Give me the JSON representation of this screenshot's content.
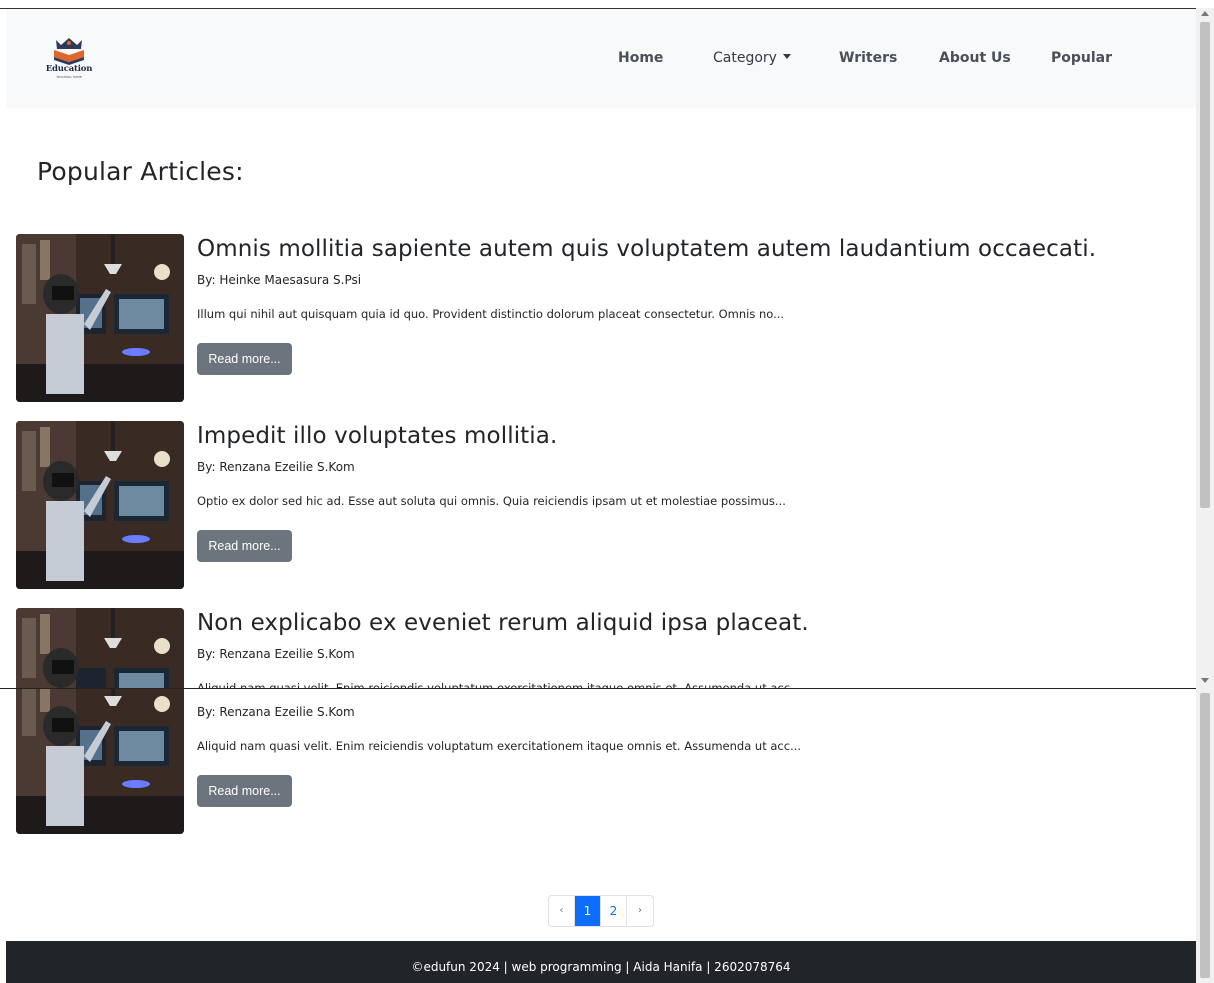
{
  "brand": {
    "logo_text": "Education",
    "logo_sub": "TEACHING HOME"
  },
  "nav": {
    "home": "Home",
    "category": "Category",
    "writers": "Writers",
    "about": "About Us",
    "popular": "Popular"
  },
  "page_title": "Popular Articles:",
  "articles": [
    {
      "title": "Omnis mollitia sapiente autem quis voluptatem autem laudantium occaecati.",
      "author": "By: Heinke Maesasura S.Psi",
      "excerpt": "Illum qui nihil aut quisquam quia id quo. Provident distinctio dolorum placeat consectetur. Omnis no...",
      "button": "Read more..."
    },
    {
      "title": "Impedit illo voluptates mollitia.",
      "author": "By: Renzana Ezeilie S.Kom",
      "excerpt": "Optio ex dolor sed hic ad. Esse aut soluta qui omnis. Quia reiciendis ipsam ut et molestiae possimus...",
      "button": "Read more..."
    },
    {
      "title": "Non explicabo ex eveniet rerum aliquid ipsa placeat.",
      "author": "By: Renzana Ezeilie S.Kom",
      "excerpt": "Aliquid nam quasi velit. Enim reiciendis voluptatum exercitationem itaque omnis et. Assumenda ut acc...",
      "button": "Read more..."
    }
  ],
  "pagination": {
    "prev": "‹",
    "pages": [
      "1",
      "2"
    ],
    "active": "1",
    "next": "›"
  },
  "footer": "©edufun 2024 | web programming | Aida Hanifa | 2602078764",
  "colors": {
    "navbar_bg": "#f8f9fa",
    "button_bg": "#6c757d",
    "accent": "#0d6efd",
    "footer_bg": "#212529"
  }
}
